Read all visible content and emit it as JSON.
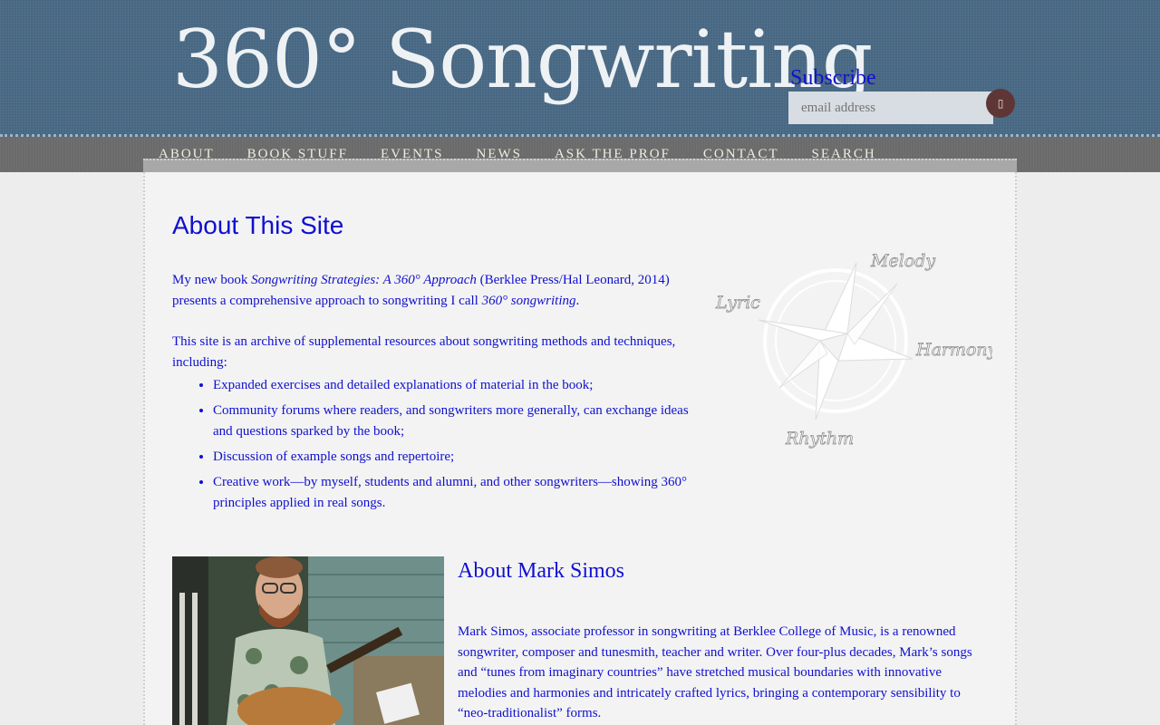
{
  "header": {
    "logo_text": "360° Songwriting",
    "subscribe_label": "Subscribe",
    "email_placeholder": "email address",
    "subscribe_button_glyph": "▯"
  },
  "nav": {
    "items": [
      "ABOUT",
      "BOOK STUFF",
      "EVENTS",
      "NEWS",
      "ASK THE PROF",
      "CONTACT",
      "SEARCH"
    ]
  },
  "main": {
    "title": "About This Site",
    "intro": {
      "prefix": "My new book ",
      "book_title": "Songwriting Strategies: A 360° Approach",
      "middle": " (Berklee Press/Hal Leonard, 2014) presents a comprehensive approach to songwriting I call ",
      "term": "360° songwriting",
      "suffix": "."
    },
    "intro2": "This site is an archive of supplemental resources about songwriting methods and techniques, including:",
    "resources": [
      "Expanded exercises and detailed explanations of material in the book;",
      "Community forums where readers, and songwriters more generally, can exchange ideas and questions sparked by the book;",
      "Discussion of example songs and repertoire;",
      "Creative work—by myself, students and alumni, and other songwriters—showing 360° principles applied in real songs."
    ],
    "compass_labels": {
      "melody": "Melody",
      "lyric": "Lyric",
      "harmony": "Harmony",
      "rhythm": "Rhythm"
    }
  },
  "bio": {
    "title": "About Mark Simos",
    "text": "Mark Simos, associate professor in songwriting at Berklee College of Music, is a renowned songwriter, composer and tunesmith, teacher and writer. Over four-plus decades, Mark’s songs and “tunes from imaginary countries” have stretched musical boundaries with innovative melodies and harmonies and intricately crafted lyrics, bringing a contemporary sensibility to “neo-traditionalist” forms."
  },
  "colors": {
    "header_bg": "#4a6a86",
    "nav_bg": "#6b6b6b",
    "link_blue": "#1010d0",
    "subscribe_button": "#5e3636"
  }
}
